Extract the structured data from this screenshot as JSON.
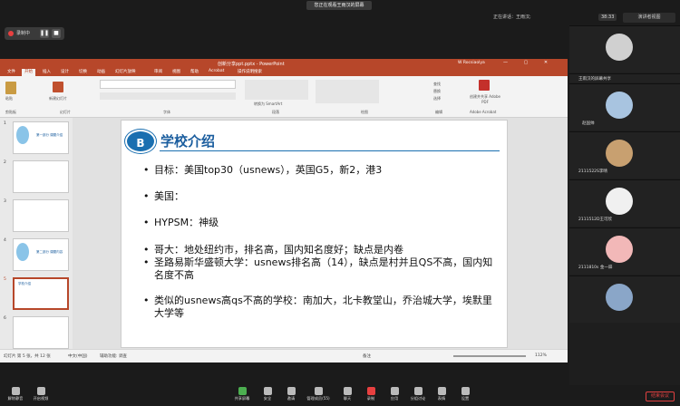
{
  "meeting": {
    "share_banner": "您正在观看王雨汉的屏幕",
    "speaking": "正在讲话：王雨汉;",
    "time": "38:33",
    "view_mode": "演讲者视图",
    "recording_label": "录制中",
    "pause_icon": "❚❚",
    "stop_icon": "■"
  },
  "ppt": {
    "filename": "创新分享ppt.pptx - PowerPoint",
    "user": "W Rocsiaolya",
    "tabs": [
      "文件",
      "开始",
      "插入",
      "设计",
      "切换",
      "动画",
      "幻灯片放映",
      "审阅",
      "视图",
      "帮助",
      "Acrobat",
      "操作说明搜索"
    ],
    "ribbon": {
      "paste": "粘贴",
      "clipboard": "剪贴板",
      "new_slide": "新建幻灯片",
      "slides": "幻灯片",
      "font": "字体",
      "paragraph": "段落",
      "convert_smartart": "转换为 SmartArt",
      "drawing": "绘图",
      "find": "查找",
      "replace": "替换",
      "select": "选择",
      "editing": "编辑",
      "create_pdf": "创建并共享 Adobe PDF",
      "adobe_acrobat": "Adobe Acrobat"
    },
    "thumbnails": [
      {
        "num": "1",
        "text": "第一部分 课题介绍"
      },
      {
        "num": "2",
        "text": ""
      },
      {
        "num": "3",
        "text": ""
      },
      {
        "num": "4",
        "text": "第二部分 课题内容"
      },
      {
        "num": "5",
        "text": "学校介绍"
      },
      {
        "num": "6",
        "text": ""
      }
    ],
    "slide": {
      "logo": "B",
      "title": "学校介绍",
      "bullets": [
        "目标：美国top30（usnews），英国G5，新2，港3",
        "美国：",
        "HYPSM：神级",
        "哥大：地处纽约市，排名高，国内知名度好；缺点是内卷",
        "圣路易斯华盛顿大学：usnews排名高（14），缺点是村并且QS不高，国内知名度不高",
        "类似的usnews高qs不高的学校：南加大，北卡教堂山，乔治城大学，埃默里大学等"
      ]
    },
    "status": {
      "slide_info": "幻灯片 第 5 张，共 12 张",
      "lang": "中文(中国)",
      "accessibility": "辅助功能: 调查",
      "notes": "备注",
      "zoom": "112%"
    }
  },
  "participants": [
    {
      "name": "",
      "color": "#d0d0d0",
      "mic": false
    },
    {
      "name": "王雨汉的屏幕共享",
      "color": "#ffffff",
      "mic": true
    },
    {
      "name": "赵国帅",
      "color": "#a8c4e0",
      "mic": true
    },
    {
      "name": "2111522S李晴",
      "color": "#c8a070",
      "mic": true
    },
    {
      "name": "2111512D王可欣",
      "color": "#f0f0f0",
      "mic": true
    },
    {
      "name": "2111810s 金一辞",
      "color": "#f2b8b8",
      "mic": true
    },
    {
      "name": "",
      "color": "#8aa6c8",
      "mic": false
    }
  ],
  "toolbar": {
    "mute": "解除静音",
    "video": "开启视频",
    "share": "共享屏幕",
    "security": "安全",
    "invite": "邀请",
    "manage": "管理成员(55)",
    "chat": "聊天",
    "record": "录制",
    "apps": "应用",
    "breakout": "分组讨论",
    "reactions": "表情",
    "settings": "设置",
    "end": "结束会议"
  }
}
